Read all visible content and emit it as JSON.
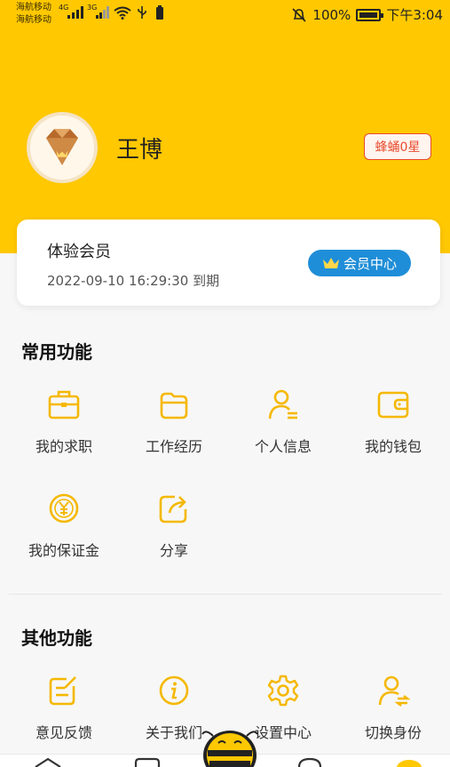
{
  "status_bar": {
    "carrier_1": "海航移动",
    "carrier_2": "海航移动",
    "network_1": "4G",
    "network_2": "3G",
    "battery": "100%",
    "time": "下午3:04"
  },
  "profile": {
    "name": "王博",
    "level": "蜂蛹0星"
  },
  "membership": {
    "title": "体验会员",
    "expiry": "2022-09-10 16:29:30 到期",
    "button": "会员中心"
  },
  "common_functions": {
    "title": "常用功能",
    "items": [
      {
        "label": "我的求职",
        "icon": "briefcase-icon"
      },
      {
        "label": "工作经历",
        "icon": "folder-icon"
      },
      {
        "label": "个人信息",
        "icon": "person-info-icon"
      },
      {
        "label": "我的钱包",
        "icon": "wallet-icon"
      },
      {
        "label": "我的保证金",
        "icon": "yuan-coin-icon"
      },
      {
        "label": "分享",
        "icon": "share-icon"
      }
    ]
  },
  "other_functions": {
    "title": "其他功能",
    "items": [
      {
        "label": "意见反馈",
        "icon": "feedback-icon"
      },
      {
        "label": "关于我们",
        "icon": "info-icon"
      },
      {
        "label": "设置中心",
        "icon": "gear-icon"
      },
      {
        "label": "切换身份",
        "icon": "switch-identity-icon"
      }
    ]
  },
  "colors": {
    "brand_yellow": "#ffc800",
    "icon_yellow": "#f5b800",
    "member_blue": "#1f8ed8",
    "badge_red": "#e84a2e"
  }
}
